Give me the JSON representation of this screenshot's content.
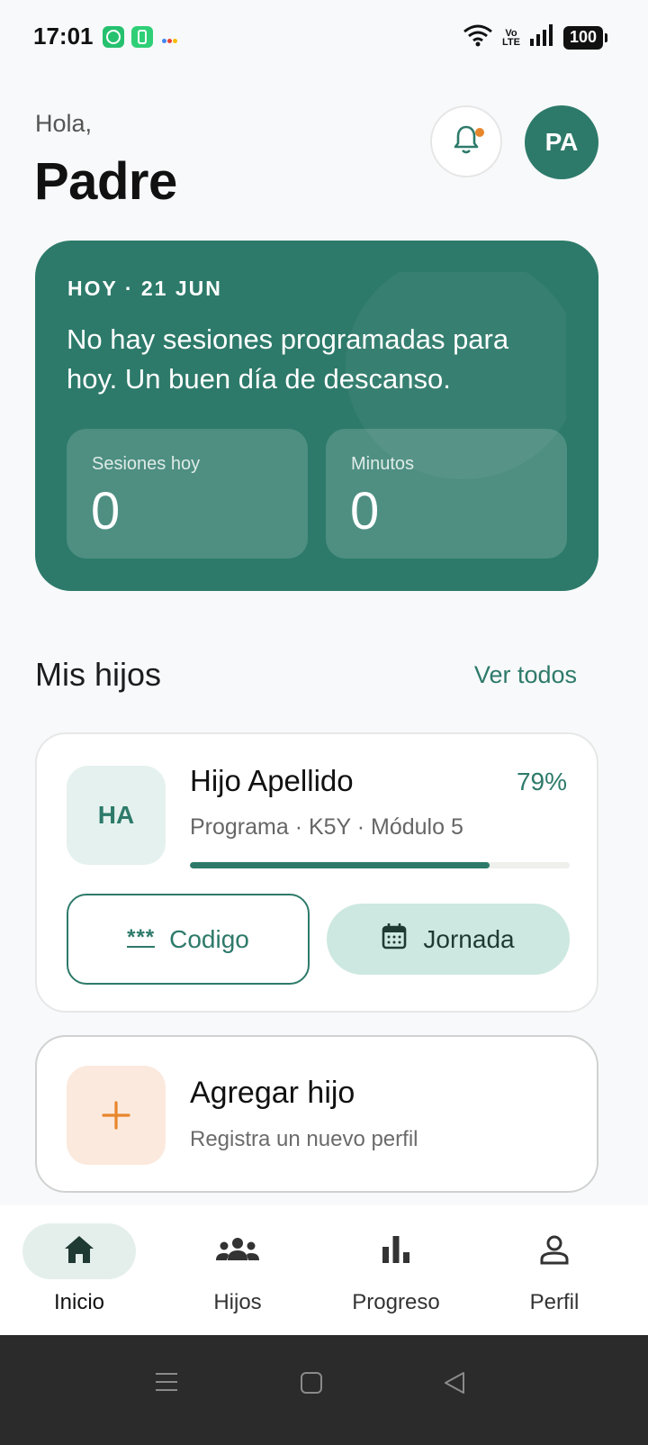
{
  "status_bar": {
    "time": "17:01",
    "network": "Vo\nLTE",
    "battery": "100"
  },
  "header": {
    "greeting": "Hola,",
    "name": "Padre",
    "avatar_initials": "PA"
  },
  "today": {
    "date_label": "HOY · 21 JUN",
    "message": "No hay sesiones programadas para hoy. Un buen día de descanso.",
    "stats": [
      {
        "label": "Sesiones hoy",
        "value": "0"
      },
      {
        "label": "Minutos",
        "value": "0"
      }
    ]
  },
  "children_section": {
    "title": "Mis hijos",
    "see_all": "Ver todos"
  },
  "child": {
    "initials": "HA",
    "name": "Hijo Apellido",
    "progress_label": "79%",
    "progress_fraction": 0.79,
    "meta": "Programa · K5Y · Módulo 5",
    "code_button": "Codigo",
    "code_icon": "***",
    "day_button": "Jornada"
  },
  "add_child": {
    "title": "Agregar hijo",
    "subtitle": "Registra un nuevo perfil"
  },
  "bottom_nav": {
    "items": [
      {
        "label": "Inicio",
        "icon": "home-icon",
        "active": true
      },
      {
        "label": "Hijos",
        "icon": "group-icon",
        "active": false
      },
      {
        "label": "Progreso",
        "icon": "bar-chart-icon",
        "active": false
      },
      {
        "label": "Perfil",
        "icon": "person-icon",
        "active": false
      }
    ]
  },
  "colors": {
    "primary": "#2d7a6a",
    "accent": "#e8862c",
    "background": "#f8f9fa"
  }
}
